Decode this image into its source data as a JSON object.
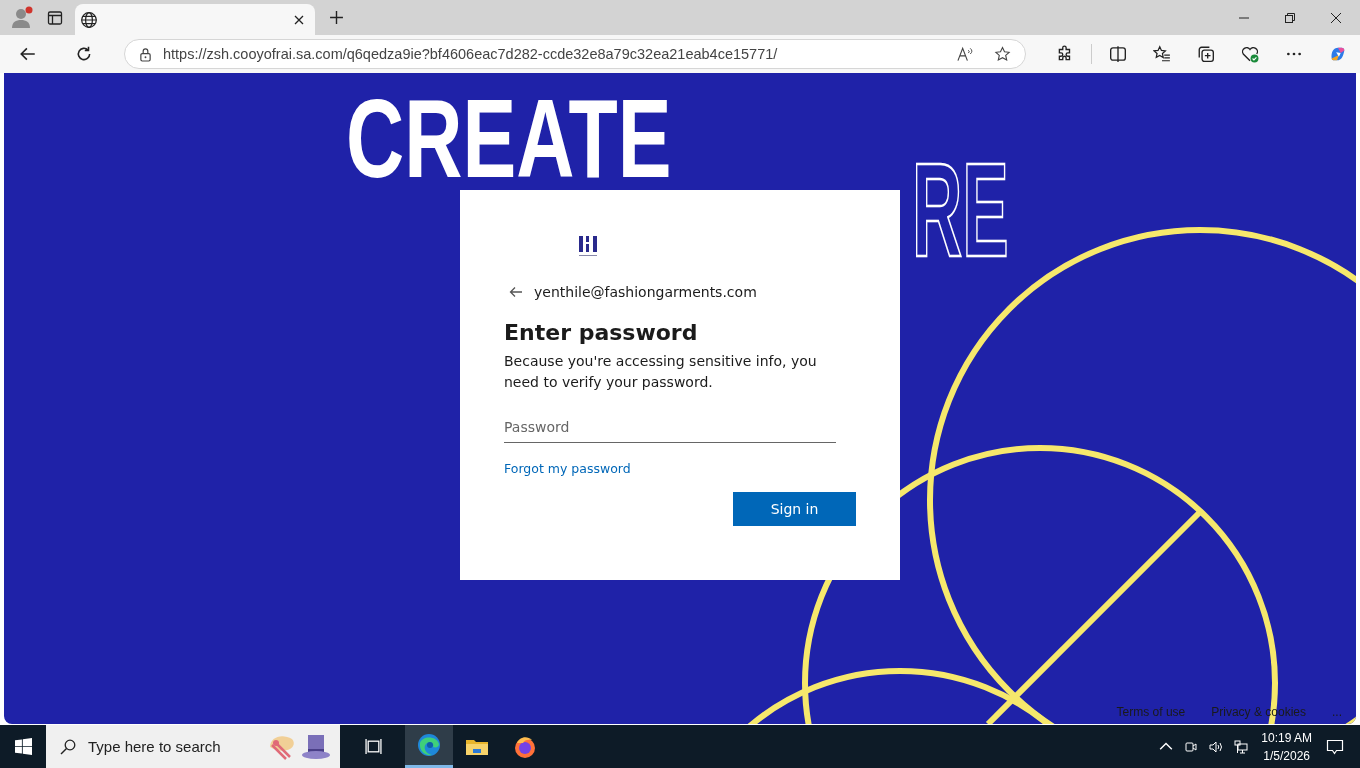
{
  "browser": {
    "address": "https://zsh.cooyofrai.sa.com/q6qedza9ie?bf4606eac7d282-ccde32e8a79c32ea21eab4ce15771/"
  },
  "hero": {
    "line_1": "CREATE",
    "line_2": "RE"
  },
  "card": {
    "account": "yenthile@fashiongarments.com",
    "title": "Enter password",
    "description": "Because you're accessing sensitive info, you need to verify your password.",
    "password": {
      "placeholder": "Password"
    },
    "forgot_link": "Forgot my password",
    "sign_in": "Sign in"
  },
  "footer": {
    "links": [
      "Terms of use",
      "Privacy & cookies",
      "..."
    ]
  },
  "taskbar": {
    "search": {
      "placeholder": "Type here to search"
    },
    "time": "10:19 AM",
    "date": "1/5/2026"
  }
}
